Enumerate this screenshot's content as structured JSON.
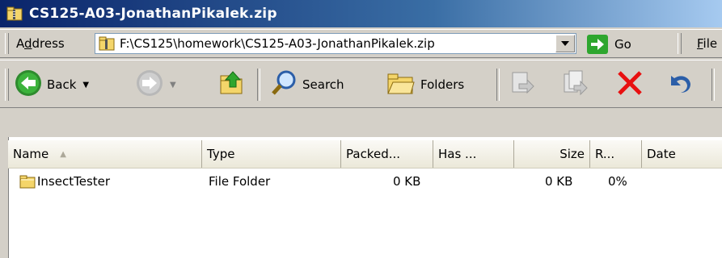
{
  "window": {
    "title": "CS125-A03-JonathanPikalek.zip"
  },
  "address_bar": {
    "label_prefix": "A",
    "label_underlined": "d",
    "label_suffix": "dress",
    "value": "F:\\CS125\\homework\\CS125-A03-JonathanPikalek.zip",
    "go_label": "Go",
    "menu_file_first": "F",
    "menu_file_rest": "ile"
  },
  "toolbar": {
    "back_label": "Back",
    "search_label": "Search",
    "folders_label": "Folders"
  },
  "list": {
    "columns": [
      "Name",
      "Type",
      "Packed...",
      "Has ...",
      "Size",
      "R...",
      "Date"
    ],
    "rows": [
      {
        "name": "InsectTester",
        "type": "File Folder",
        "packed": "0 KB",
        "has": "",
        "size": "0 KB",
        "ratio": "0%",
        "date": ""
      }
    ]
  },
  "colors": {
    "title_bar": "#0a246a",
    "go_green": "#2ea62e",
    "delete_red": "#e81010",
    "folder_yellow": "#f4d56a"
  },
  "icons": [
    "zip-folder-icon",
    "dropdown-arrow-icon",
    "go-arrow-icon",
    "back-icon",
    "forward-icon",
    "up-folder-icon",
    "search-icon",
    "folders-icon",
    "move-to-icon",
    "copy-to-icon",
    "delete-icon",
    "undo-icon",
    "folder-icon",
    "sort-up-icon"
  ]
}
